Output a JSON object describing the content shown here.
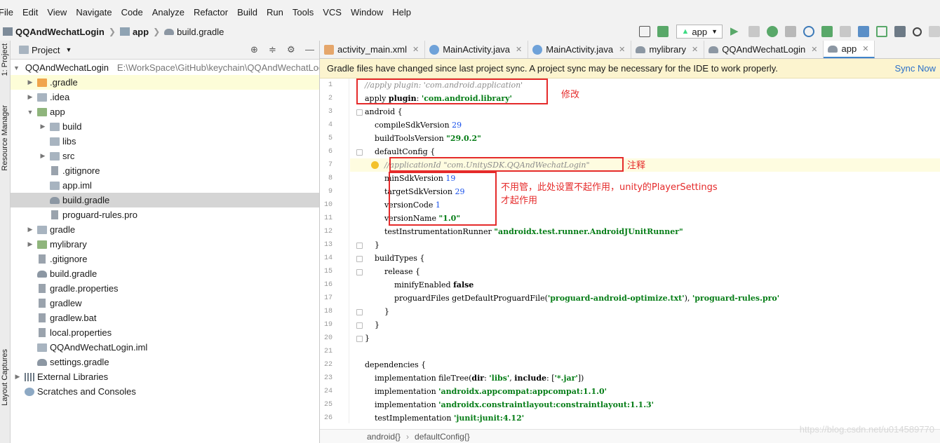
{
  "menu": [
    "File",
    "Edit",
    "View",
    "Navigate",
    "Code",
    "Analyze",
    "Refactor",
    "Build",
    "Run",
    "Tools",
    "VCS",
    "Window",
    "Help"
  ],
  "nav": {
    "project": "QQAndWechatLogin",
    "module": "app",
    "file": "build.gradle"
  },
  "toolbar": {
    "run_config": "app"
  },
  "stripe": {
    "project": "1: Project",
    "resource": "Resource Manager",
    "layout": "Layout Captures"
  },
  "project_panel": {
    "title": "Project",
    "root": "QQAndWechatLogin",
    "root_path": "E:\\WorkSpace\\GitHub\\keychain\\QQAndWechatLogin",
    "items": [
      ".gradle",
      ".idea",
      "app",
      "build",
      "libs",
      "src",
      ".gitignore",
      "app.iml",
      "build.gradle",
      "proguard-rules.pro",
      "gradle",
      "mylibrary",
      ".gitignore",
      "build.gradle",
      "gradle.properties",
      "gradlew",
      "gradlew.bat",
      "local.properties",
      "QQAndWechatLogin.iml",
      "settings.gradle",
      "External Libraries",
      "Scratches and Consoles"
    ]
  },
  "tabs": [
    "activity_main.xml",
    "MainActivity.java",
    "MainActivity.java",
    "mylibrary",
    "QQAndWechatLogin",
    "app"
  ],
  "banner": {
    "text": "Gradle files have changed since last project sync. A project sync may be necessary for the IDE to work properly.",
    "action": "Sync Now"
  },
  "annotations": {
    "modify": "修改",
    "comment": "注释",
    "note_line1": "不用管，此处设置不起作用，unity的PlayerSettings",
    "note_line2": "才起作用"
  },
  "code_breadcrumb": [
    "android{}",
    "defaultConfig{}"
  ],
  "watermark": "https://blog.csdn.net/u014589770",
  "colors": {
    "accent": "#4083c9",
    "annotation_red": "#e52b2b",
    "banner_bg": "#fcf4cf",
    "string_green": "#067d17"
  }
}
